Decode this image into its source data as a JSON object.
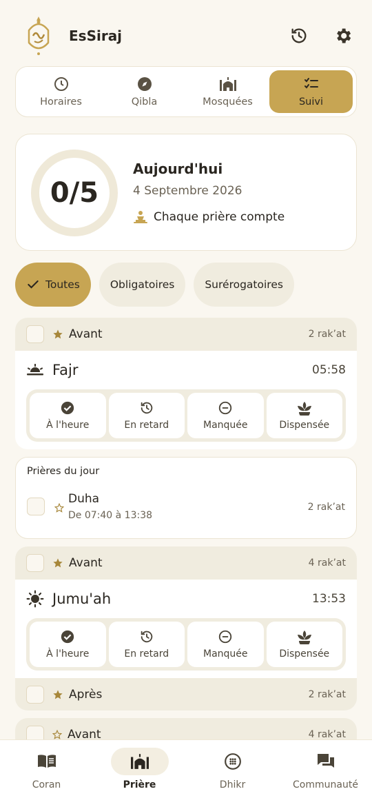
{
  "app": {
    "title": "EsSiraj"
  },
  "colors": {
    "accent": "#c7a553",
    "background": "#faf7f0",
    "chip": "#f0ecdf",
    "star": "#a7873a"
  },
  "header": {
    "icons": [
      "history-icon",
      "gear-icon"
    ]
  },
  "tabs": [
    {
      "label": "Horaires",
      "icon": "clock-icon"
    },
    {
      "label": "Qibla",
      "icon": "compass-icon"
    },
    {
      "label": "Mosquées",
      "icon": "mosque-icon"
    },
    {
      "label": "Suivi",
      "icon": "checklist-icon",
      "active": true
    }
  ],
  "summary": {
    "count": "0/5",
    "completed": 0,
    "total": 5,
    "title": "Aujourd'hui",
    "date": "4 Septembre 2026",
    "motto": "Chaque prière compte"
  },
  "filters": [
    {
      "label": "Toutes",
      "active": true
    },
    {
      "label": "Obligatoires"
    },
    {
      "label": "Surérogatoires"
    }
  ],
  "status_labels": {
    "on_time": "À l'heure",
    "late": "En retard",
    "missed": "Manquée",
    "exempt": "Dispensée"
  },
  "fajr": {
    "before": {
      "label": "Avant",
      "rakat": "2 rak’at"
    },
    "name": "Fajr",
    "time": "05:58"
  },
  "daily": {
    "title": "Prières du jour",
    "duha": {
      "name": "Duha",
      "range": "De 07:40 à 13:38",
      "rakat": "2 rak’at"
    }
  },
  "jumuah": {
    "before": {
      "label": "Avant",
      "rakat": "4 rak’at"
    },
    "name": "Jumu'ah",
    "time": "13:53",
    "after": {
      "label": "Après",
      "rakat": "2 rak’at"
    }
  },
  "next": {
    "before": {
      "label": "Avant",
      "rakat": "4 rak’at"
    }
  },
  "bottom_nav": [
    {
      "label": "Coran",
      "icon": "book-icon"
    },
    {
      "label": "Prière",
      "icon": "mosque-icon",
      "active": true
    },
    {
      "label": "Dhikr",
      "icon": "dhikr-icon"
    },
    {
      "label": "Communauté",
      "icon": "chat-icon"
    }
  ]
}
